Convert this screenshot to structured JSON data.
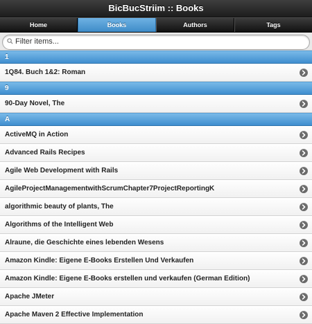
{
  "header": {
    "title": "BicBucStriim :: Books"
  },
  "navbar": {
    "tabs": [
      {
        "label": "Home",
        "active": false
      },
      {
        "label": "Books",
        "active": true
      },
      {
        "label": "Authors",
        "active": false
      },
      {
        "label": "Tags",
        "active": false
      }
    ]
  },
  "filter": {
    "placeholder": "Filter items...",
    "value": ""
  },
  "icons": {
    "row_arrow": "chevron-right-icon",
    "filter": "search-icon"
  },
  "colors": {
    "accent": "#4a9ad6",
    "header_bg": "#2b2b2b"
  },
  "sections": [
    {
      "letter": "1",
      "items": [
        "1Q84. Buch 1&2: Roman"
      ]
    },
    {
      "letter": "9",
      "items": [
        "90-Day Novel, The"
      ]
    },
    {
      "letter": "A",
      "items": [
        "ActiveMQ in Action",
        "Advanced Rails Recipes",
        "Agile Web Development with Rails",
        "AgileProjectManagementwithScrumChapter7ProjectReportingK",
        "algorithmic beauty of plants, The",
        "Algorithms of the Intelligent Web",
        "Alraune, die Geschichte eines lebenden Wesens",
        "Amazon Kindle: Eigene E-Books Erstellen Und Verkaufen",
        "Amazon Kindle: Eigene E-Books erstellen und verkaufen (German Edition)",
        "Apache JMeter",
        "Apache Maven 2 Effective Implementation"
      ]
    }
  ]
}
